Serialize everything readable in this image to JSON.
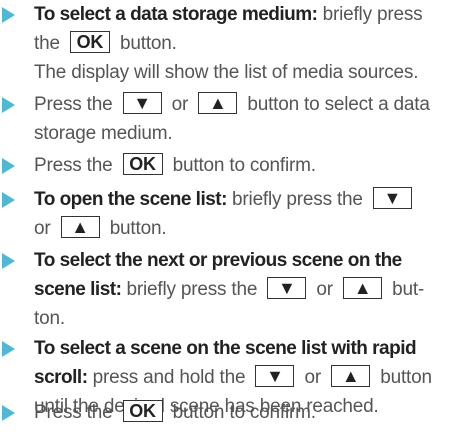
{
  "colors": {
    "bullet": "#4fb8d4",
    "text": "#555555",
    "lead_text": "#222222"
  },
  "keys": {
    "ok": "OK",
    "down": "▼",
    "up": "▲"
  },
  "steps": [
    {
      "lead": "To select a data storage medium:",
      "text": [
        " briefly press",
        "the",
        "button.",
        "The display will show the list of media sources."
      ]
    },
    {
      "text": [
        "Press the",
        "or",
        "button to select a data",
        "storage medium."
      ]
    },
    {
      "text": [
        "Press the",
        "button to confirm."
      ]
    },
    {
      "lead": "To open the scene list:",
      "text": [
        " briefly press the",
        "or",
        "button."
      ]
    },
    {
      "lead": [
        "To select the next or previous scene on the",
        "scene list:"
      ],
      "text": [
        " briefly press the",
        "or",
        "but-",
        "ton."
      ]
    },
    {
      "lead": [
        "To select a scene on the scene list with rapid",
        "scroll:"
      ],
      "text": [
        " press and hold the",
        "or",
        "button",
        "until the desired scene has been reached."
      ]
    },
    {
      "text": [
        "Press the",
        "button to confirm."
      ]
    }
  ]
}
